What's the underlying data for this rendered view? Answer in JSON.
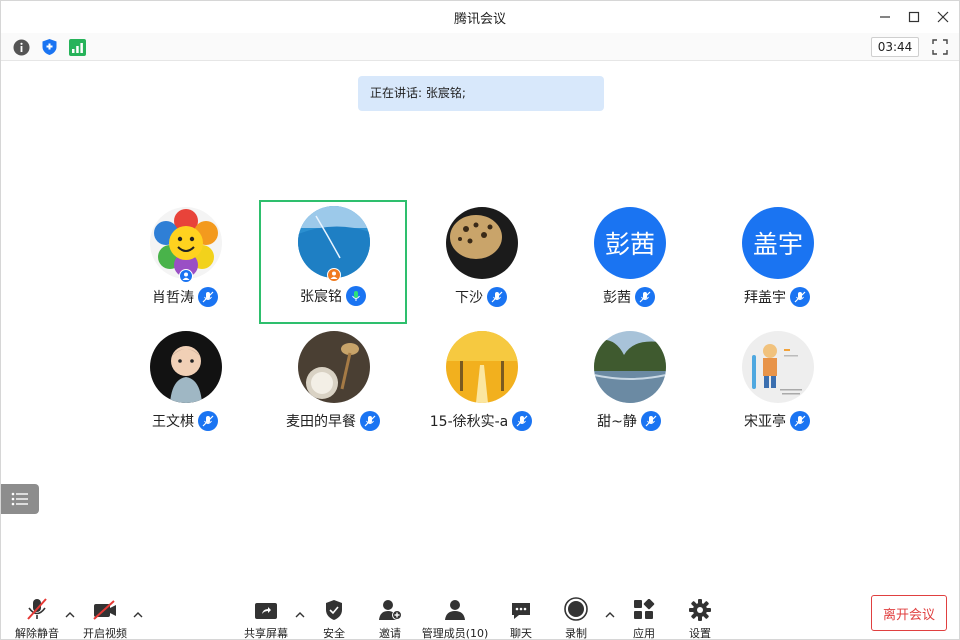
{
  "window": {
    "title": "腾讯会议"
  },
  "status": {
    "timer": "03:44"
  },
  "banner": {
    "speaking": "正在讲话: 张宸铭;"
  },
  "participants": [
    {
      "name": "肖哲涛"
    },
    {
      "name": "张宸铭"
    },
    {
      "name": "下沙"
    },
    {
      "name": "彭茜",
      "avatar_text": "彭茜"
    },
    {
      "name": "拜盖宇",
      "avatar_text": "盖宇"
    },
    {
      "name": "王文棋"
    },
    {
      "name": "麦田的早餐"
    },
    {
      "name": "15-徐秋实-a"
    },
    {
      "name": "甜~静"
    },
    {
      "name": "宋亚亭"
    }
  ],
  "toolbar": {
    "unmute": "解除静音",
    "start_video": "开启视频",
    "share_screen": "共享屏幕",
    "security": "安全",
    "invite": "邀请",
    "manage_members": "管理成员(10)",
    "chat": "聊天",
    "record": "录制",
    "apps": "应用",
    "settings": "设置",
    "leave": "离开会议"
  },
  "colors": {
    "accent_blue": "#1a74f2",
    "active_green": "#2ebf6d",
    "leave_red": "#e04040",
    "banner_bg": "#d8e8fb"
  }
}
